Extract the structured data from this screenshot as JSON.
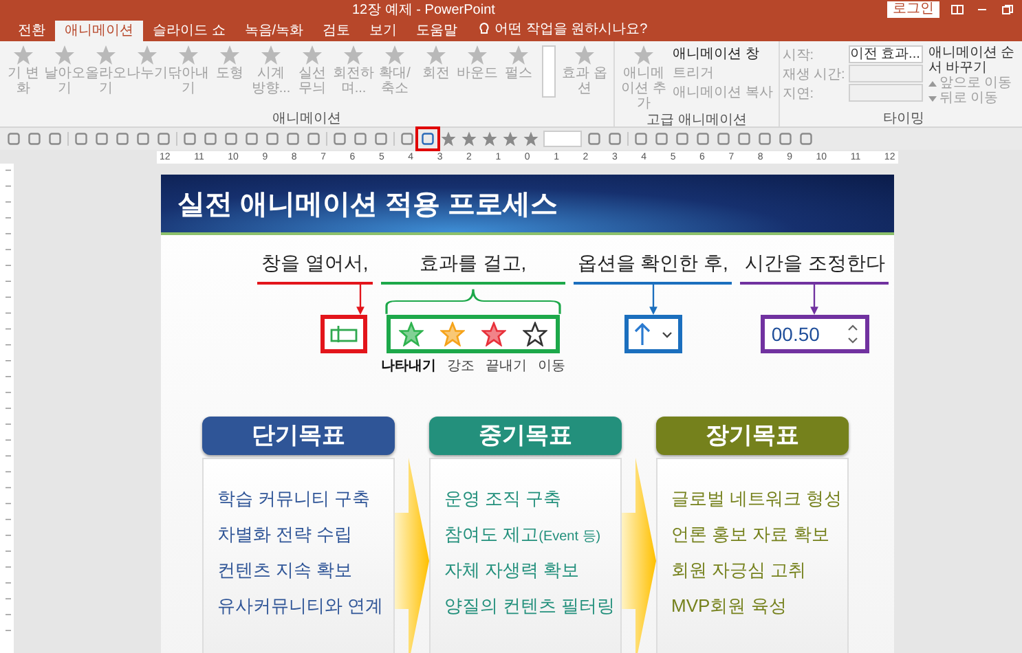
{
  "window": {
    "title": "12장 예제 - PowerPoint",
    "login": "로그인"
  },
  "tabs": [
    {
      "label": "전환",
      "selected": false
    },
    {
      "label": "애니메이션",
      "selected": true
    },
    {
      "label": "슬라이드 쇼",
      "selected": false
    },
    {
      "label": "녹음/녹화",
      "selected": false
    },
    {
      "label": "검토",
      "selected": false
    },
    {
      "label": "보기",
      "selected": false
    },
    {
      "label": "도움말",
      "selected": false
    }
  ],
  "tell_me": "어떤 작업을 원하시나요?",
  "ribbon": {
    "gallery": {
      "label": "애니메이션",
      "disabled": true,
      "items": [
        "기 변화",
        "날아오기",
        "올라오기",
        "나누기",
        "닦아내기",
        "도형",
        "시계 방향...",
        "실선 무늬",
        "회전하며...",
        "확대/축소",
        "회전",
        "바운드",
        "펄스"
      ],
      "options": "효과 옵션"
    },
    "advanced": {
      "label": "고급 애니메이션",
      "add": "애니메이션 추가",
      "items": [
        {
          "label": "애니메이션 창",
          "disabled": false
        },
        {
          "label": "트리거",
          "disabled": true
        },
        {
          "label": "애니메이션 복사",
          "disabled": true
        }
      ]
    },
    "timing": {
      "label": "타이밍",
      "rows": [
        {
          "label": "시작:",
          "value": "이전 효과...",
          "kind": "dropdown",
          "disabled": true
        },
        {
          "label": "재생 시간:",
          "kind": "spinner",
          "disabled": true
        },
        {
          "label": "지연:",
          "kind": "spinner",
          "disabled": true
        }
      ],
      "reorder": {
        "title": "애니메이션 순서 바꾸기",
        "buttons": [
          {
            "label": "앞으로 이동",
            "kind": "up",
            "disabled": true
          },
          {
            "label": "뒤로 이동",
            "kind": "down",
            "disabled": true
          }
        ]
      }
    }
  },
  "toolbar": [
    {
      "kind": "glyph",
      "highlighted": false
    },
    {
      "kind": "glyph",
      "highlighted": false
    },
    {
      "kind": "glyph",
      "highlighted": false
    },
    {
      "kind": "sep"
    },
    {
      "kind": "glyph",
      "highlighted": false
    },
    {
      "kind": "glyph",
      "highlighted": false
    },
    {
      "kind": "glyph",
      "highlighted": false
    },
    {
      "kind": "glyph",
      "highlighted": false
    },
    {
      "kind": "glyph",
      "highlighted": false
    },
    {
      "kind": "sep"
    },
    {
      "kind": "glyph",
      "highlighted": false
    },
    {
      "kind": "glyph",
      "highlighted": false
    },
    {
      "kind": "glyph",
      "highlighted": false
    },
    {
      "kind": "glyph",
      "highlighted": false
    },
    {
      "kind": "glyph",
      "highlighted": false
    },
    {
      "kind": "glyph",
      "highlighted": false
    },
    {
      "kind": "glyph",
      "highlighted": false
    },
    {
      "kind": "sep"
    },
    {
      "kind": "glyph",
      "highlighted": false
    },
    {
      "kind": "glyph",
      "highlighted": false
    },
    {
      "kind": "glyph",
      "highlighted": false
    },
    {
      "kind": "sep"
    },
    {
      "kind": "glyph",
      "highlighted": false
    },
    {
      "kind": "glyph",
      "highlighted": true
    },
    {
      "kind": "star",
      "highlighted": false
    },
    {
      "kind": "star",
      "highlighted": false
    },
    {
      "kind": "star",
      "highlighted": false
    },
    {
      "kind": "star",
      "highlighted": false
    },
    {
      "kind": "star",
      "highlighted": false
    },
    {
      "kind": "field",
      "highlighted": false
    },
    {
      "kind": "glyph",
      "highlighted": false
    },
    {
      "kind": "glyph",
      "highlighted": false
    },
    {
      "kind": "sep"
    },
    {
      "kind": "glyph",
      "highlighted": false
    },
    {
      "kind": "glyph",
      "highlighted": false
    },
    {
      "kind": "glyph",
      "highlighted": false
    },
    {
      "kind": "glyph",
      "highlighted": false
    },
    {
      "kind": "glyph",
      "highlighted": false
    },
    {
      "kind": "glyph",
      "highlighted": false
    },
    {
      "kind": "glyph",
      "highlighted": false
    },
    {
      "kind": "glyph",
      "highlighted": false
    },
    {
      "kind": "glyph",
      "highlighted": false
    }
  ],
  "ruler": [
    "12",
    "11",
    "10",
    "9",
    "8",
    "7",
    "6",
    "5",
    "4",
    "3",
    "2",
    "1",
    "0",
    "1",
    "2",
    "3",
    "4",
    "5",
    "6",
    "7",
    "8",
    "9",
    "10",
    "11",
    "12"
  ],
  "slide": {
    "title": "실전 애니메이션 적용 프로세스",
    "steps": [
      {
        "label": "창을 열어서,",
        "color": "#e3151b",
        "connector": {
          "kind": "arrow"
        },
        "control": {
          "kind": "pane_button"
        }
      },
      {
        "label": "효과를 걸고,",
        "color": "#1da84a",
        "connector": {
          "kind": "brace"
        },
        "control": {
          "kind": "effects",
          "effects": [
            {
              "label": "나타내기",
              "selected": true,
              "color": "#2fb34f"
            },
            {
              "label": "강조",
              "selected": false,
              "color": "#f5a31a"
            },
            {
              "label": "끝내기",
              "selected": false,
              "color": "#e8303a"
            },
            {
              "label": "이동",
              "selected": false,
              "color": "#333333"
            }
          ]
        }
      },
      {
        "label": "옵션을 확인한 후,",
        "color": "#1b6fbe",
        "connector": {
          "kind": "arrow"
        },
        "control": {
          "kind": "direction"
        }
      },
      {
        "label": "시간을 조정한다",
        "color": "#7132a0",
        "connector": {
          "kind": "arrow"
        },
        "control": {
          "kind": "spinner",
          "value": "00.50"
        }
      }
    ],
    "cards": [
      {
        "title": "단기목표",
        "color": "#2f5597",
        "items": [
          {
            "text": "학습 커뮤니티 구축"
          },
          {
            "text": "차별화 전략 수립"
          },
          {
            "text": "컨텐츠 지속 확보"
          },
          {
            "text": "유사커뮤니티와 연계"
          }
        ]
      },
      {
        "title": "중기목표",
        "color": "#23907c",
        "items": [
          {
            "text": "운영 조직 구축"
          },
          {
            "text": "참여도 제고",
            "note": "(Event 등)"
          },
          {
            "text": "자체 자생력 확보"
          },
          {
            "text": "양질의 컨텐츠 필터링"
          }
        ]
      },
      {
        "title": "장기목표",
        "color": "#75811c",
        "items": [
          {
            "text": "글로벌 네트워크 형성"
          },
          {
            "text": "언론 홍보 자료 확보"
          },
          {
            "text": "회원 자긍심 고취"
          },
          {
            "text": "MVP회원 육성"
          }
        ]
      }
    ]
  }
}
